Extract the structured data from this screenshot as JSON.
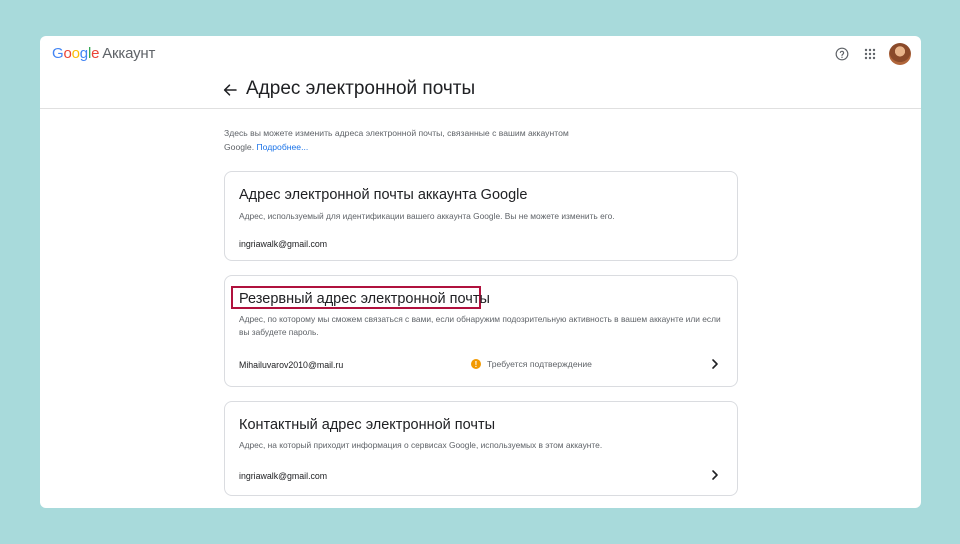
{
  "app": {
    "logo_letters": [
      "G",
      "o",
      "o",
      "g",
      "l",
      "e"
    ],
    "product": "Аккаунт"
  },
  "header": {
    "title": "Адрес электронной почты"
  },
  "intro": {
    "text": "Здесь вы можете изменить адреса электронной почты, связанные с вашим аккаунтом Google.",
    "link": "Подробнее..."
  },
  "cards": [
    {
      "title": "Адрес электронной почты аккаунта Google",
      "description": "Адрес, используемый для идентификации вашего аккаунта Google. Вы не можете изменить его.",
      "email": "ingriawalk@gmail.com"
    },
    {
      "title": "Резервный адрес электронной почты",
      "description": "Адрес, по которому мы сможем связаться с вами, если обнаружим подозрительную активность в вашем аккаунте или если вы забудете пароль.",
      "email": "Mihailuvarov2010@mail.ru",
      "status": "Требуется подтверждение"
    },
    {
      "title": "Контактный адрес электронной почты",
      "description": "Адрес, на который приходит информация о сервисах Google, используемых в этом аккаунте.",
      "email": "ingriawalk@gmail.com"
    }
  ],
  "icons": {
    "help": "help-circle-icon",
    "apps": "apps-grid-icon",
    "back": "arrow-left-icon",
    "chevron": "chevron-right-icon",
    "warning": "warning-icon"
  },
  "colors": {
    "background": "#a8dadb",
    "link": "#1a73e8",
    "highlight": "#b0113d",
    "warning": "#f29900"
  }
}
